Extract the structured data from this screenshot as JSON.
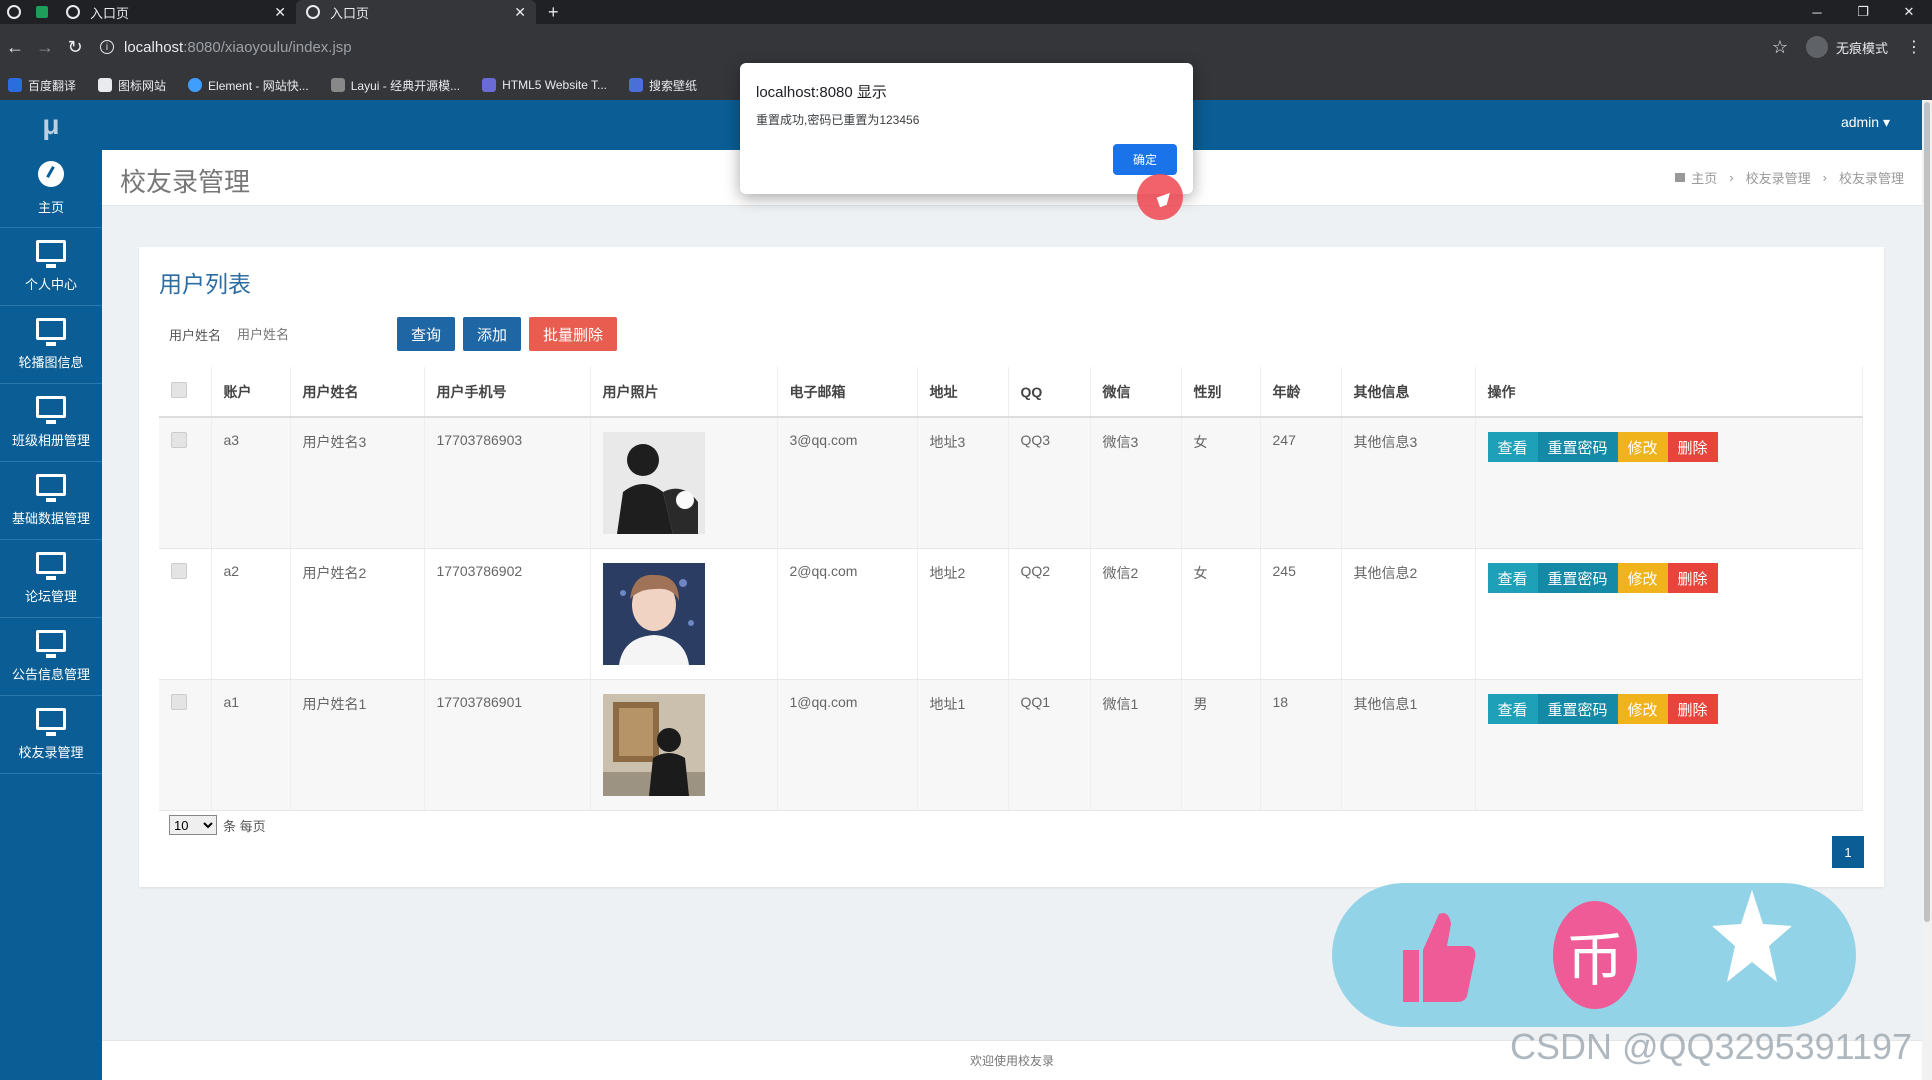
{
  "browser": {
    "tabs": [
      {
        "label": "入口页"
      },
      {
        "label": "入口页"
      }
    ],
    "url_host": "localhost",
    "url_path": ":8080/xiaoyoulu/index.jsp",
    "incognito_label": "无痕模式",
    "bookmarks": [
      {
        "label": "百度翻译",
        "color": "#2b6cdf"
      },
      {
        "label": "图标网站",
        "color": "#e8eaed"
      },
      {
        "label": "Element - 网站快...",
        "color": "#409eff"
      },
      {
        "label": "Layui - 经典开源模...",
        "color": "#888888"
      },
      {
        "label": "HTML5 Website T...",
        "color": "#6b6bd6"
      },
      {
        "label": "搜索壁纸",
        "color": "#4a6fd9"
      }
    ]
  },
  "app": {
    "logo": "μ",
    "user": "admin ▾",
    "sidebar": [
      {
        "label": "主页",
        "icon": "dashboard-icon"
      },
      {
        "label": "个人中心",
        "icon": "monitor-icon"
      },
      {
        "label": "轮播图信息",
        "icon": "monitor-icon"
      },
      {
        "label": "班级相册管理",
        "icon": "monitor-icon"
      },
      {
        "label": "基础数据管理",
        "icon": "monitor-icon"
      },
      {
        "label": "论坛管理",
        "icon": "monitor-icon"
      },
      {
        "label": "公告信息管理",
        "icon": "monitor-icon"
      },
      {
        "label": "校友录管理",
        "icon": "monitor-icon"
      }
    ],
    "page_title": "校友录管理",
    "breadcrumb": [
      "主页",
      "校友录管理",
      "校友录管理"
    ]
  },
  "list": {
    "title": "用户列表",
    "search_label": "用户姓名",
    "search_placeholder": "用户姓名",
    "btn_query": "查询",
    "btn_add": "添加",
    "btn_batch_delete": "批量删除",
    "columns": [
      "账户",
      "用户姓名",
      "用户手机号",
      "用户照片",
      "电子邮箱",
      "地址",
      "QQ",
      "微信",
      "性别",
      "年龄",
      "其他信息",
      "操作"
    ],
    "rows": [
      {
        "account": "a3",
        "name": "用户姓名3",
        "phone": "17703786903",
        "photo": "silhouette-photo",
        "email": "3@qq.com",
        "address": "地址3",
        "qq": "QQ3",
        "wechat": "微信3",
        "gender": "女",
        "age": "247",
        "other": "其他信息3"
      },
      {
        "account": "a2",
        "name": "用户姓名2",
        "phone": "17703786902",
        "photo": "portrait-photo",
        "email": "2@qq.com",
        "address": "地址2",
        "qq": "QQ2",
        "wechat": "微信2",
        "gender": "女",
        "age": "245",
        "other": "其他信息2"
      },
      {
        "account": "a1",
        "name": "用户姓名1",
        "phone": "17703786901",
        "photo": "gallery-photo",
        "email": "1@qq.com",
        "address": "地址1",
        "qq": "QQ1",
        "wechat": "微信1",
        "gender": "男",
        "age": "18",
        "other": "其他信息1"
      }
    ],
    "op_view": "查看",
    "op_reset": "重置密码",
    "op_edit": "修改",
    "op_delete": "删除",
    "page_size": "10",
    "per_page_label": "条 每页",
    "current_page": "1"
  },
  "footer": "欢迎使用校友录",
  "dialog": {
    "title": "localhost:8080 显示",
    "message": "重置成功,密码已重置为123456",
    "ok": "确定"
  },
  "overlay": {
    "coin_glyph": "币",
    "watermark": "CSDN @QQ3295391197"
  }
}
